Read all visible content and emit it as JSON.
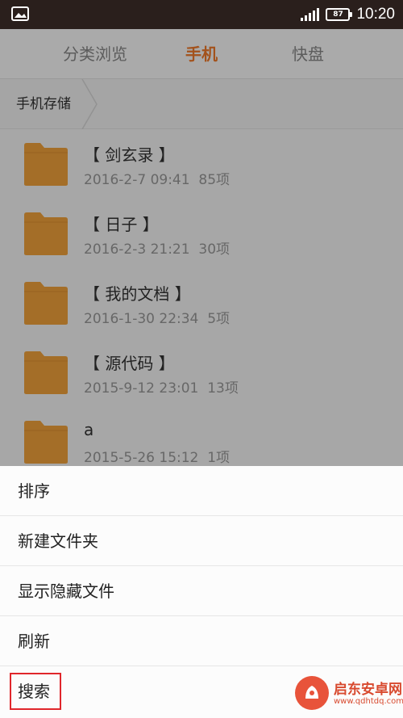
{
  "status_bar": {
    "time": "10:20",
    "battery_label": "87",
    "notification_icon": "image-icon",
    "signal_icon": "signal-bars-icon"
  },
  "tabs": [
    {
      "label": "分类浏览",
      "active": false
    },
    {
      "label": "手机",
      "active": true
    },
    {
      "label": "快盘",
      "active": false
    }
  ],
  "breadcrumb": {
    "label": "手机存储"
  },
  "files": [
    {
      "name": "【 剑玄录 】",
      "date": "2016-2-7 09:41",
      "count": "85项"
    },
    {
      "name": "【 日子 】",
      "date": "2016-2-3 21:21",
      "count": "30项"
    },
    {
      "name": "【 我的文档 】",
      "date": "2016-1-30 22:34",
      "count": "5项"
    },
    {
      "name": "【 源代码 】",
      "date": "2015-9-12 23:01",
      "count": "13项"
    },
    {
      "name": "a",
      "date": "2015-5-26 15:12",
      "count": "1项"
    }
  ],
  "menu": [
    {
      "label": "排序"
    },
    {
      "label": "新建文件夹"
    },
    {
      "label": "显示隐藏文件"
    },
    {
      "label": "刷新"
    },
    {
      "label": "搜索",
      "highlighted": true
    }
  ],
  "watermark": {
    "title": "启东安卓网",
    "url": "www.qdhtdq.com"
  },
  "colors": {
    "accent": "#f07a2a",
    "folder": "#f2a23c",
    "highlight": "#e0262b",
    "status_bar": "#2a1f1c"
  }
}
